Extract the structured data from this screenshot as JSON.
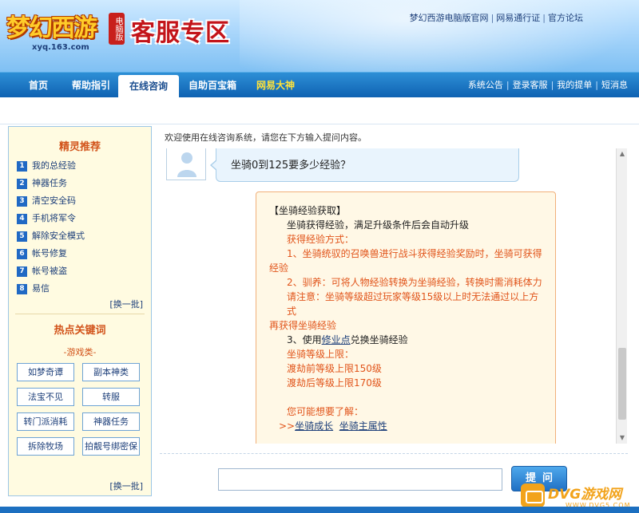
{
  "header": {
    "logo_text": "梦幻西游",
    "logo_badge": "电脑版",
    "logo_url": "xyq.163.com",
    "zone_title": "客服专区",
    "top_links": [
      "梦幻西游电脑版官网",
      "网易通行证",
      "官方论坛"
    ]
  },
  "nav": {
    "items": [
      "首页",
      "帮助指引",
      "在线咨询",
      "自助百宝箱",
      "网易大神"
    ],
    "active": "在线咨询",
    "right_links": [
      "系统公告",
      "登录客服",
      "我的提单",
      "短消息"
    ]
  },
  "sidebar": {
    "rec_title": "精灵推荐",
    "rec_items": [
      {
        "num": "1",
        "label": "我的总经验"
      },
      {
        "num": "2",
        "label": "神器任务"
      },
      {
        "num": "3",
        "label": "清空安全码"
      },
      {
        "num": "4",
        "label": "手机将军令"
      },
      {
        "num": "5",
        "label": "解除安全模式"
      },
      {
        "num": "6",
        "label": "帐号修复"
      },
      {
        "num": "7",
        "label": "帐号被盗"
      },
      {
        "num": "8",
        "label": "易信"
      }
    ],
    "more1": "[换一批]",
    "kw_title": "热点关键词",
    "kw_category": "-游戏类-",
    "keywords": [
      "如梦奇谭",
      "副本神类",
      "法宝不见",
      "转服",
      "转门派消耗",
      "神器任务",
      "拆除牧场",
      "拍靓号绑密保"
    ],
    "more2": "[换一批]"
  },
  "main": {
    "welcome": "欢迎使用在线咨询系统，请您在下方输入提问内容。",
    "question": "坐骑0到125要多少经验？",
    "answer": {
      "title": "【坐骑经验获取】",
      "l1": "坐骑获得经验，满足升级条件后会自动升级",
      "l2": "获得经验方式：",
      "l3": "1、坐骑统驭的召唤兽进行战斗获得经验奖励时，坐骑可获得",
      "l3b": "经验",
      "l4": "2、驯养：可将人物经验转换为坐骑经验，转换时需消耗体力",
      "l5": "请注意：坐骑等级超过玩家等级15级以上时无法通过以上方式",
      "l5b": "再获得坐骑经验",
      "l6_pre": "3、使用",
      "l6_link": "修业点",
      "l6_post": "兑换坐骑经验",
      "l7": "坐骑等级上限：",
      "l8": "渡劫前等级上限150级",
      "l9": "渡劫后等级上限170级",
      "l10": "您可能想要了解：",
      "l11_pre": ">>",
      "l11_link1": "坐骑成长",
      "l11_link2": "坐骑主属性"
    },
    "input_value": "",
    "ask_button": "提问"
  },
  "watermark": {
    "text": "DVG游戏网",
    "url": "WWW.DVG5.COM"
  },
  "colors": {
    "nav_blue": "#0f62b2",
    "accent_orange": "#e1541a",
    "title_red": "#c3141a"
  }
}
